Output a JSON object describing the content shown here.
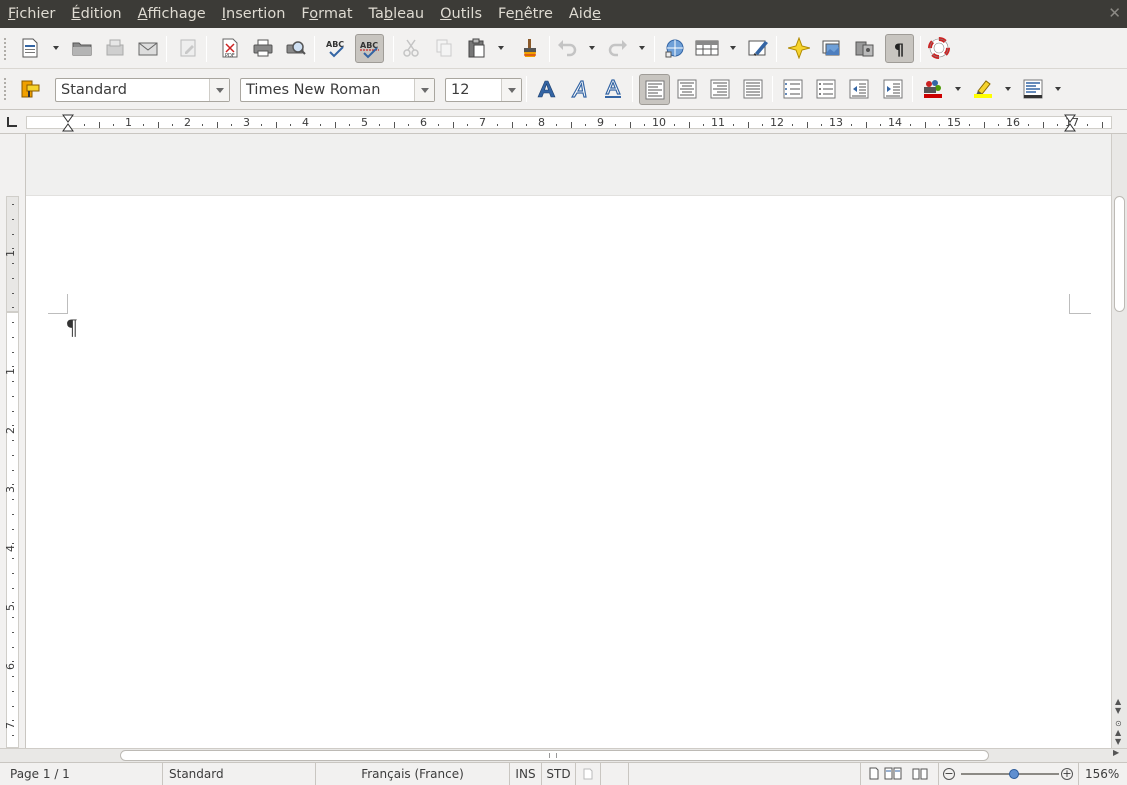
{
  "menubar": {
    "items": [
      {
        "pre": "",
        "u": "F",
        "post": "ichier"
      },
      {
        "pre": "",
        "u": "É",
        "post": "dition"
      },
      {
        "pre": "",
        "u": "A",
        "post": "ffichage"
      },
      {
        "pre": "",
        "u": "I",
        "post": "nsertion"
      },
      {
        "pre": "F",
        "u": "o",
        "post": "rmat"
      },
      {
        "pre": "Ta",
        "u": "b",
        "post": "leau"
      },
      {
        "pre": "",
        "u": "O",
        "post": "utils"
      },
      {
        "pre": "Fe",
        "u": "n",
        "post": "être"
      },
      {
        "pre": "Aid",
        "u": "e",
        "post": ""
      }
    ],
    "close_glyph": "✕"
  },
  "formatting": {
    "paragraph_style": "Standard",
    "font_name": "Times New Roman",
    "font_size": "12"
  },
  "ruler": {
    "h_numbers": [
      "1",
      "2",
      "3",
      "4",
      "5",
      "6",
      "7",
      "8",
      "9",
      "10",
      "11",
      "12",
      "13",
      "14",
      "15",
      "16",
      "17"
    ],
    "v_numbers": [
      "1",
      "1",
      "2",
      "3",
      "4",
      "5",
      "6",
      "7"
    ]
  },
  "document": {
    "pilcrow": "¶"
  },
  "status": {
    "page": "Page 1 / 1",
    "page_style": "Standard",
    "language": "Français (France)",
    "insert_mode": "INS",
    "selection_mode": "STD",
    "zoom": "156%"
  },
  "colors": {
    "menubar_bg": "#3c3b37",
    "chrome_bg": "#f2f1f0",
    "accent_blue": "#3465a4",
    "spell_red": "#cc0000",
    "pdf_red": "#cc2222"
  }
}
